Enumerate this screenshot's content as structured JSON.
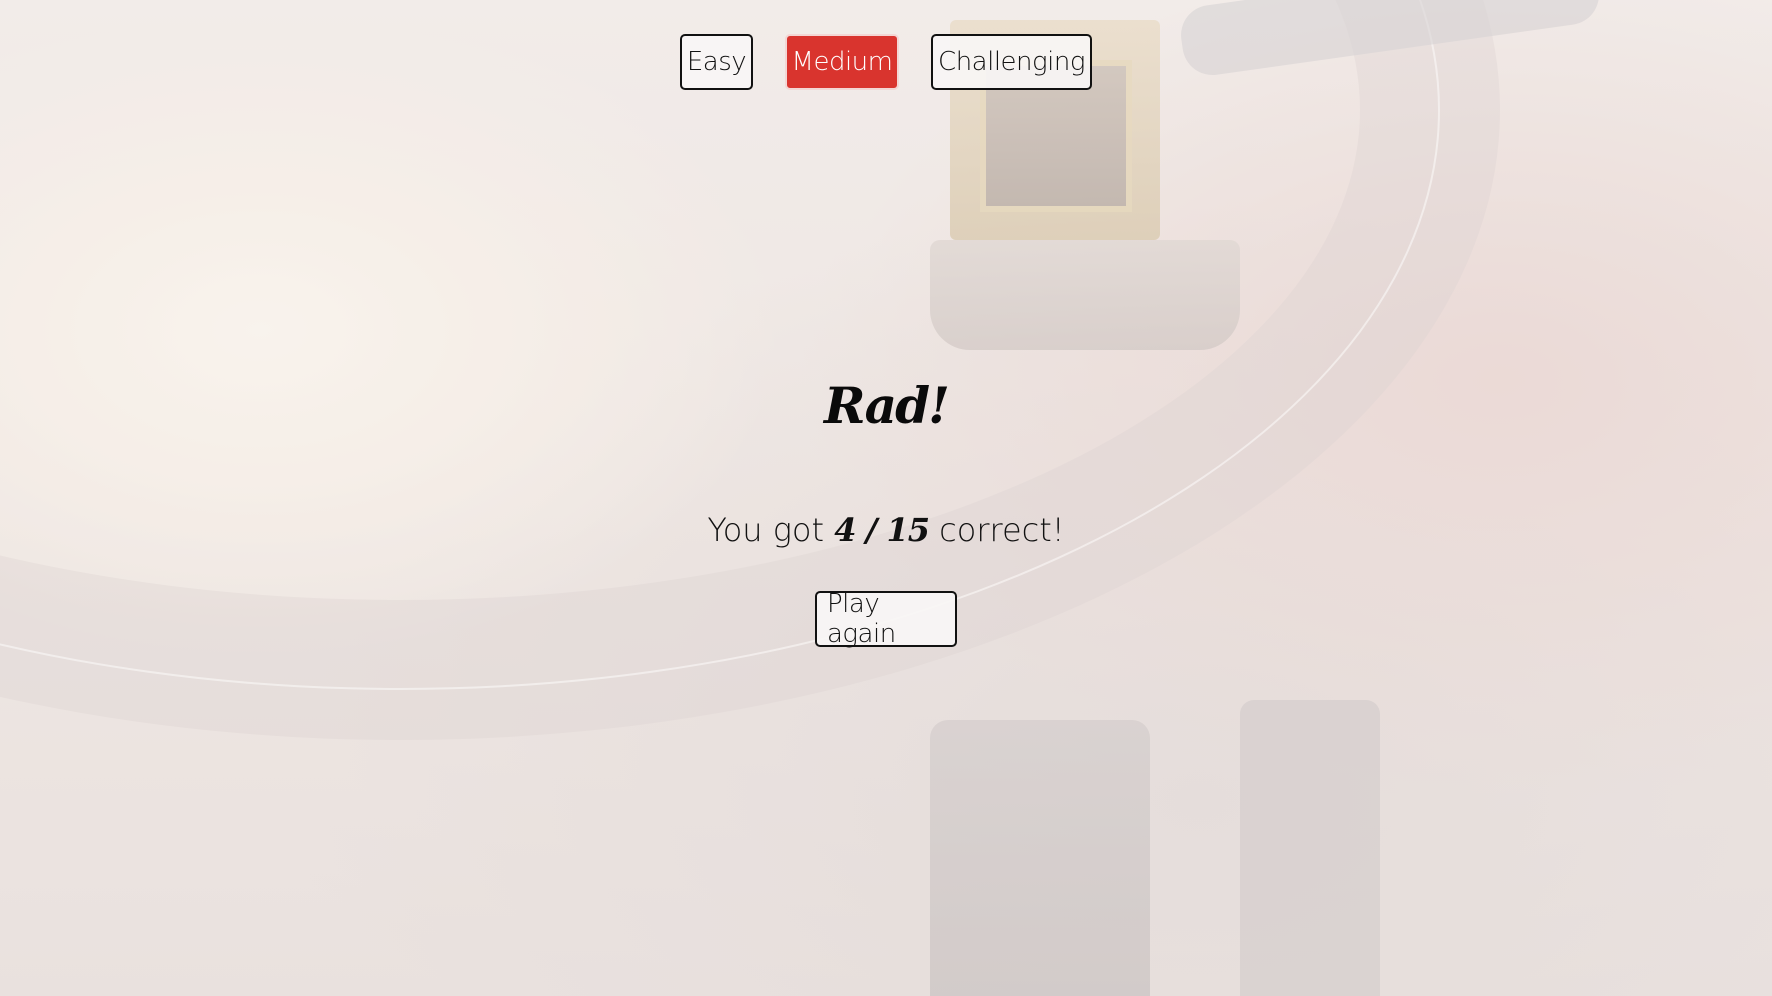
{
  "difficulty": {
    "options": [
      {
        "label": "Easy",
        "active": false
      },
      {
        "label": "Medium",
        "active": true
      },
      {
        "label": "Challenging",
        "active": false
      }
    ]
  },
  "result": {
    "headline": "Rad!",
    "score_prefix": "You got",
    "score_value": "4 / 15",
    "score_suffix": "correct!",
    "correct": 4,
    "total": 15
  },
  "actions": {
    "play_again_label": "Play again"
  },
  "colors": {
    "active_button": "#d9342e",
    "text": "#111111"
  }
}
